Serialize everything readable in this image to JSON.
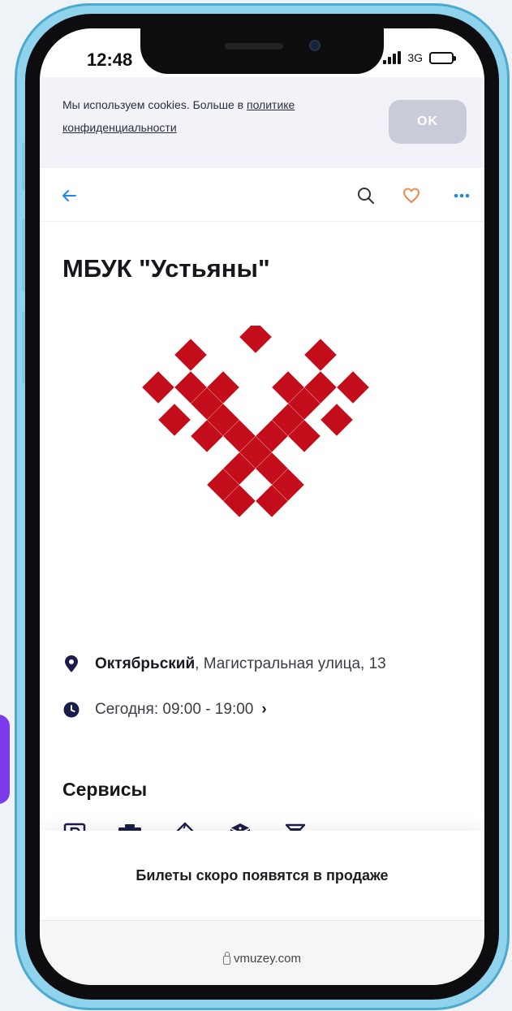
{
  "status_bar": {
    "time": "12:48",
    "network": "3G"
  },
  "cookie_banner": {
    "text_before": "Мы используем cookies. Больше в ",
    "link_text_1": "политике",
    "link_text_2": "конфиденциальности",
    "ok_label": "OK"
  },
  "toolbar": {
    "back_icon": "arrow-left-icon",
    "search_icon": "search-icon",
    "favorite_icon": "heart-icon",
    "more_icon": "more-dots-icon"
  },
  "page": {
    "title": "МБУК \"Устьяны\""
  },
  "address": {
    "city": "Октябрьский",
    "street": ", Магистральная улица, 13"
  },
  "hours": {
    "text": "Сегодня: 09:00 - 19:00",
    "chevron": "›"
  },
  "services": {
    "title": "Сервисы",
    "icons": [
      "parking-icon",
      "camera-icon",
      "baby-icon",
      "game-dice-icon",
      "cocktail-icon"
    ],
    "more": "›"
  },
  "tickets": {
    "text": "Билеты скоро появятся в продаже"
  },
  "browser": {
    "url": "vmuzey.com"
  },
  "colors": {
    "accent_blue": "#1e88e5",
    "heart_orange": "#f08a4b",
    "logo_red": "#c40d1a",
    "icon_navy": "#1a1d4a"
  }
}
